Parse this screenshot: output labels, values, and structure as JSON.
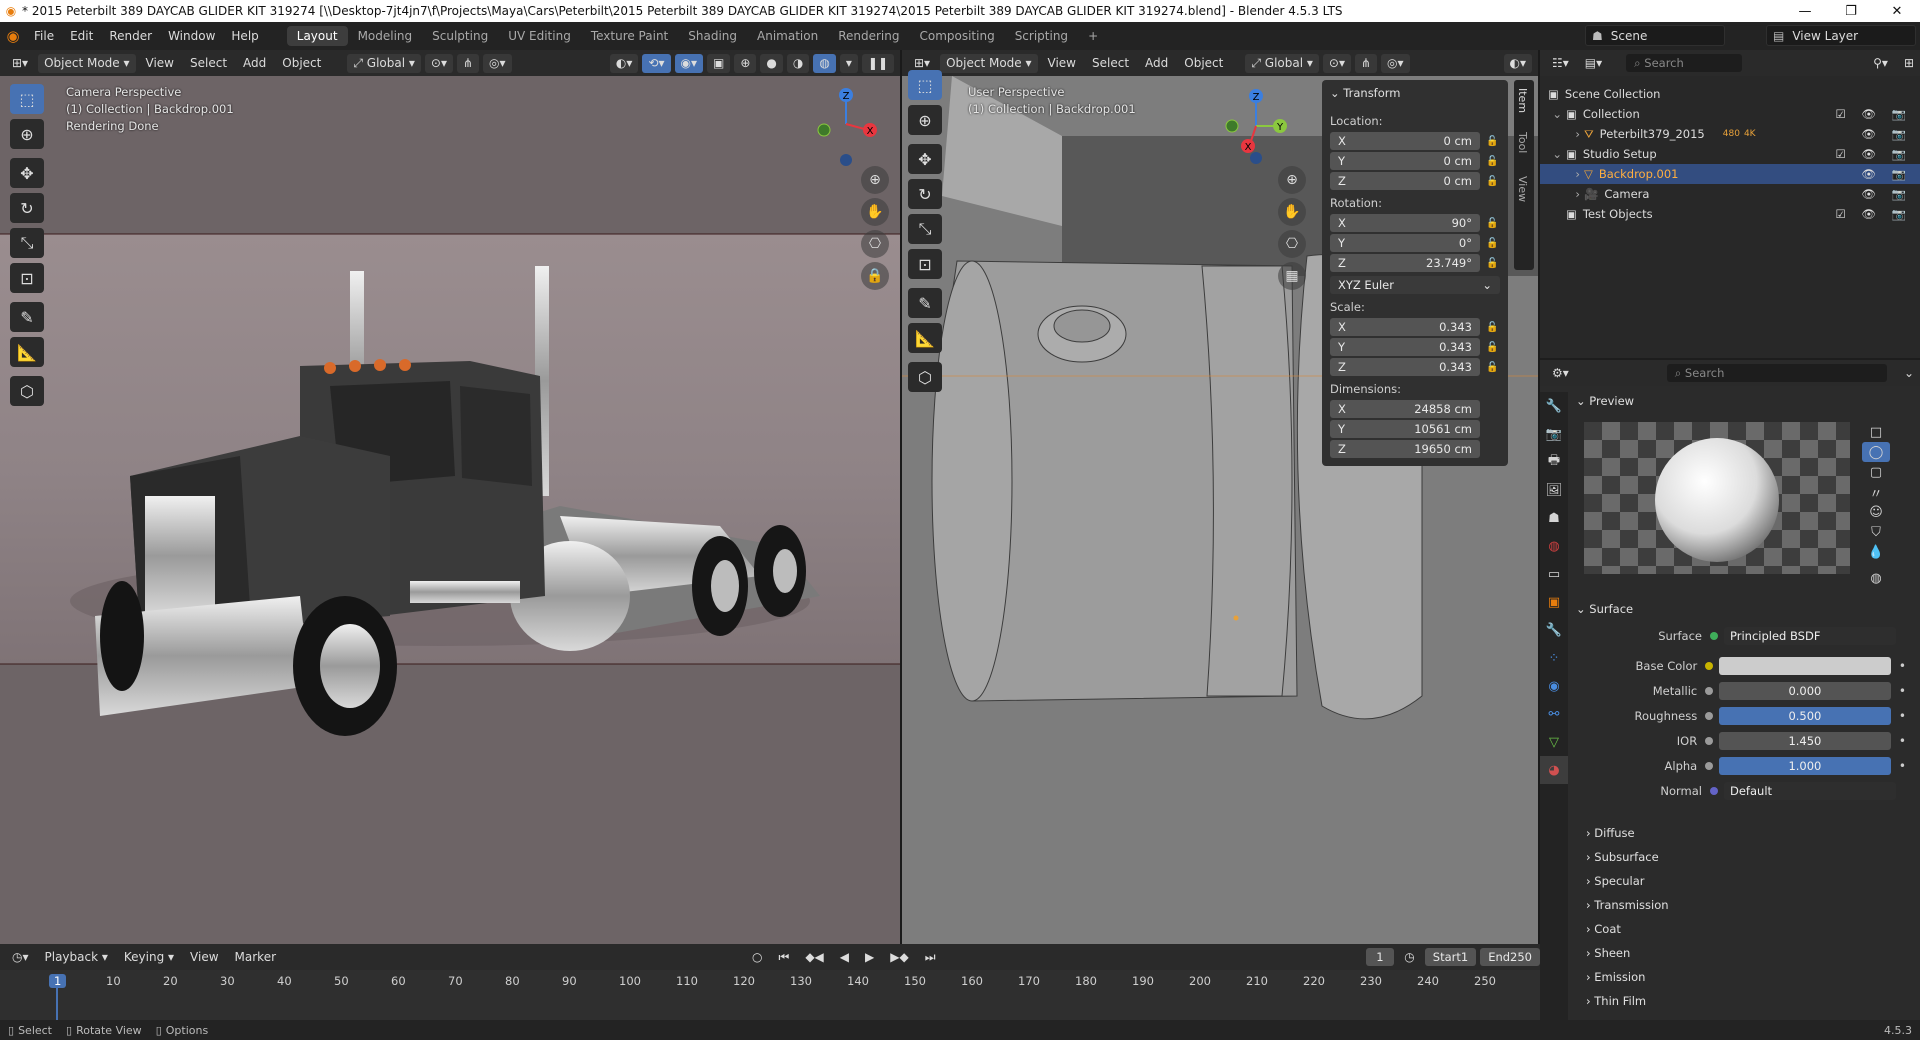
{
  "window": {
    "title": "* 2015 Peterbilt 389 DAYCAB GLIDER KIT 319274 [\\\\Desktop-7jt4jn7\\f\\Projects\\Maya\\Cars\\Peterbilt\\2015 Peterbilt 389 DAYCAB GLIDER KIT 319274\\2015 Peterbilt 389 DAYCAB GLIDER KIT 319274.blend] - Blender 4.5.3 LTS",
    "minimize": "—",
    "maximize": "❐",
    "close": "✕"
  },
  "menu": [
    "File",
    "Edit",
    "Render",
    "Window",
    "Help"
  ],
  "workspaces": [
    "Layout",
    "Modeling",
    "Sculpting",
    "UV Editing",
    "Texture Paint",
    "Shading",
    "Animation",
    "Rendering",
    "Compositing",
    "Scripting",
    "+"
  ],
  "active_workspace": "Layout",
  "scene": "Scene",
  "view_layer": "View Layer",
  "viewport_left": {
    "mode": "Object Mode",
    "menus": [
      "View",
      "Select",
      "Add",
      "Object"
    ],
    "orientation": "Global",
    "overlay_lines": [
      "Camera Perspective",
      "(1) Collection | Backdrop.001",
      "Rendering Done"
    ],
    "gizmo": {
      "z": "Z",
      "x": "X"
    }
  },
  "viewport_right": {
    "mode": "Object Mode",
    "menus": [
      "View",
      "Select",
      "Add",
      "Object"
    ],
    "orientation": "Global",
    "overlay_lines": [
      "User Perspective",
      "(1) Collection | Backdrop.001"
    ],
    "gizmo": {
      "z": "Z",
      "x": "X",
      "y": "Y"
    },
    "side_tabs": [
      "Item",
      "Tool",
      "View"
    ],
    "transform": {
      "title": "Transform",
      "location_label": "Location:",
      "location": [
        {
          "axis": "X",
          "value": "0 cm"
        },
        {
          "axis": "Y",
          "value": "0 cm"
        },
        {
          "axis": "Z",
          "value": "0 cm"
        }
      ],
      "rotation_label": "Rotation:",
      "rotation": [
        {
          "axis": "X",
          "value": "90°"
        },
        {
          "axis": "Y",
          "value": "0°"
        },
        {
          "axis": "Z",
          "value": "23.749°"
        }
      ],
      "rotation_mode": "XYZ Euler",
      "scale_label": "Scale:",
      "scale": [
        {
          "axis": "X",
          "value": "0.343"
        },
        {
          "axis": "Y",
          "value": "0.343"
        },
        {
          "axis": "Z",
          "value": "0.343"
        }
      ],
      "dimensions_label": "Dimensions:",
      "dimensions": [
        {
          "axis": "X",
          "value": "24858 cm"
        },
        {
          "axis": "Y",
          "value": "10561 cm"
        },
        {
          "axis": "Z",
          "value": "19650 cm"
        }
      ]
    }
  },
  "outliner": {
    "search_placeholder": "Search",
    "rows": [
      {
        "label": "Scene Collection",
        "indent": 0
      },
      {
        "label": "Collection",
        "indent": 1
      },
      {
        "label": "Peterbilt379_2015",
        "indent": 2,
        "badge": "480",
        "badge2": "4K"
      },
      {
        "label": "Studio Setup",
        "indent": 1
      },
      {
        "label": "Backdrop.001",
        "indent": 2
      },
      {
        "label": "Camera",
        "indent": 2
      },
      {
        "label": "Test Objects",
        "indent": 1
      }
    ]
  },
  "properties": {
    "search_placeholder": "Search",
    "preview_label": "Preview",
    "surface_section": "Surface",
    "surface_row": {
      "label": "Surface",
      "value": "Principled BSDF"
    },
    "rows": [
      {
        "label": "Base Color",
        "value": "",
        "color": "#cccccc",
        "dot": "#c8b400"
      },
      {
        "label": "Metallic",
        "value": "0.000",
        "color": "#545454",
        "dot": "#9b9b9b"
      },
      {
        "label": "Roughness",
        "value": "0.500",
        "color": "#4772b3",
        "dot": "#9b9b9b"
      },
      {
        "label": "IOR",
        "value": "1.450",
        "color": "#545454",
        "dot": "#9b9b9b"
      },
      {
        "label": "Alpha",
        "value": "1.000",
        "color": "#4772b3",
        "dot": "#9b9b9b"
      },
      {
        "label": "Normal",
        "value": "Default",
        "color": "#2e2e2e",
        "dot": "#6363c7"
      }
    ],
    "subsections": [
      "Diffuse",
      "Subsurface",
      "Specular",
      "Transmission",
      "Coat",
      "Sheen",
      "Emission",
      "Thin Film"
    ]
  },
  "timeline": {
    "menus": [
      "Playback",
      "Keying",
      "View",
      "Marker"
    ],
    "current_frame": "1",
    "start_label": "Start",
    "start": "1",
    "end_label": "End",
    "end": "250",
    "ticks": [
      "1",
      "10",
      "20",
      "30",
      "40",
      "50",
      "60",
      "70",
      "80",
      "90",
      "100",
      "110",
      "120",
      "130",
      "140",
      "150",
      "160",
      "170",
      "180",
      "190",
      "200",
      "210",
      "220",
      "230",
      "240",
      "250"
    ]
  },
  "statusbar": {
    "items": [
      "Select",
      "Rotate View",
      "Options"
    ],
    "version": "4.5.3"
  },
  "colors": {
    "accent": "#4772b3",
    "selected_row": "#334d80",
    "x_axis": "#e8363f",
    "y_axis": "#8bc83f",
    "z_axis": "#3b7fe0",
    "orange": "#e87d0d"
  }
}
